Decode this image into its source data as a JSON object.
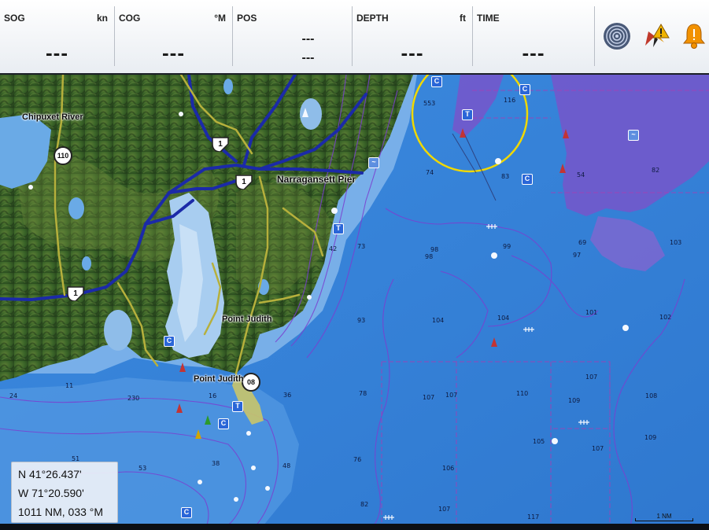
{
  "databar": {
    "sog": {
      "label": "SOG",
      "unit": "kn",
      "value": "---"
    },
    "cog": {
      "label": "COG",
      "unit": "°M",
      "value": "---"
    },
    "pos": {
      "label": "POS",
      "lat": "---",
      "lon": "---"
    },
    "depth": {
      "label": "DEPTH",
      "unit": "ft",
      "value": "---"
    },
    "time": {
      "label": "TIME",
      "value": "---"
    }
  },
  "icons": {
    "sonar": "sonar-icon",
    "wind_alert": "wind-alert-icon",
    "alarm": "alarm-bell-icon"
  },
  "places": {
    "chipuxet": "Chipuxet River",
    "narragansett": "Narragansett Pier",
    "point_judith_town": "Point Judith",
    "point_judith_pond": "Point Judith"
  },
  "routes": {
    "r110": "110",
    "r108": "08",
    "us1_a": "1",
    "us1_b": "1",
    "us1_c": "1"
  },
  "depths": [
    "553",
    "116",
    "74",
    "83",
    "54",
    "82",
    "42",
    "73",
    "98",
    "98",
    "99",
    "69",
    "97",
    "103",
    "93",
    "104",
    "104",
    "101",
    "102",
    "78",
    "107",
    "107",
    "110",
    "107",
    "109",
    "108",
    "105",
    "107",
    "109",
    "76",
    "106",
    "82",
    "107",
    "117",
    "11",
    "24",
    "230",
    "16",
    "36",
    "53",
    "38",
    "48",
    "51"
  ],
  "cursor": {
    "lat": "N  41°26.437'",
    "lon": "W  71°20.590'",
    "range": "1011 NM, 033 °M"
  },
  "scale": {
    "label": "1 NM"
  },
  "colors": {
    "deep_water": "#3a86d8",
    "shallow_water": "#9cc8ef",
    "land_green": "#2f5a25",
    "road_yellow": "#b6b03c",
    "highway_blue": "#1b2aa8",
    "contour_purple": "#7a3fc9",
    "guard_ring": "#f0d800"
  }
}
